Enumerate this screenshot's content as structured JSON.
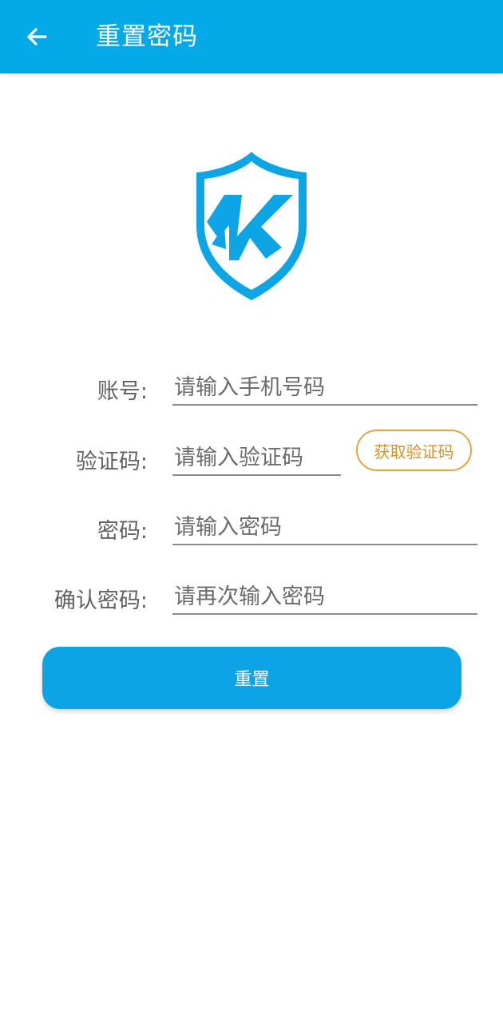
{
  "header": {
    "back_icon": "arrow-left-icon",
    "title": "重置密码"
  },
  "logo": {
    "icon": "shield-k-logo",
    "color": "#0ea5e6"
  },
  "form": {
    "account": {
      "label": "账号:",
      "placeholder": "请输入手机号码"
    },
    "code": {
      "label": "验证码:",
      "placeholder": "请输入验证码",
      "button": "获取验证码"
    },
    "password": {
      "label": "密码:",
      "placeholder": "请输入密码"
    },
    "confirm": {
      "label": "确认密码:",
      "placeholder": "请再次输入密码"
    }
  },
  "actions": {
    "reset_label": "重置"
  },
  "colors": {
    "header_bg": "#04a9e8",
    "primary": "#0da4e5",
    "accent_orange": "#e8a43a"
  }
}
